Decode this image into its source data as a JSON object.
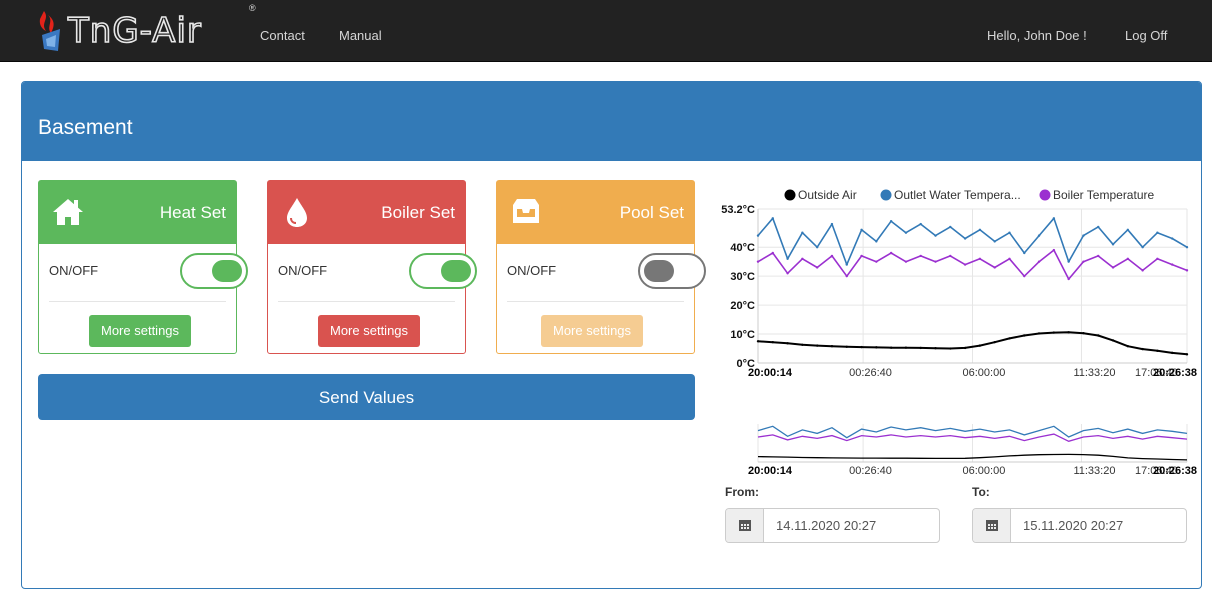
{
  "navbar": {
    "brand": "TnG-Air",
    "registered_mark": "®",
    "links": [
      "Contact",
      "Manual"
    ],
    "greeting": "Hello, John Doe !",
    "logoff": "Log Off",
    "background_color": "#222222"
  },
  "panel": {
    "title": "Basement",
    "heading_color": "#337ab7"
  },
  "cards": [
    {
      "title": "Heat Set",
      "icon": "home-icon",
      "toggle_label": "ON/OFF",
      "toggle_on": true,
      "button_label": "More settings",
      "color": "#5cb85c",
      "button_disabled": false
    },
    {
      "title": "Boiler Set",
      "icon": "water-drop-icon",
      "toggle_label": "ON/OFF",
      "toggle_on": true,
      "button_label": "More settings",
      "color": "#d9534f",
      "button_disabled": false
    },
    {
      "title": "Pool Set",
      "icon": "inbox-icon",
      "toggle_label": "ON/OFF",
      "toggle_on": false,
      "button_label": "More settings",
      "color": "#f0ad4e",
      "button_disabled": true
    }
  ],
  "send_button": "Send Values",
  "date_range": {
    "from_label": "From:",
    "to_label": "To:",
    "from_value": "14.11.2020 20:27",
    "to_value": "15.11.2020 20:27",
    "icon": "calendar-icon"
  },
  "chart_data": [
    {
      "type": "line",
      "legend_position": "top",
      "ylim": [
        0,
        53.2
      ],
      "y_tick_labels": [
        "0°C",
        "10°C",
        "20°C",
        "30°C",
        "40°C",
        "53.2°C"
      ],
      "x_tick_labels": [
        "20:00:14",
        "00:26:40",
        "06:00:00",
        "11:33:20",
        "17:06:40",
        "20:26:38"
      ],
      "grid": true,
      "series": [
        {
          "name": "Outside Air",
          "color": "#000000",
          "values": [
            7.5,
            7.2,
            6.8,
            6.3,
            6.0,
            5.8,
            5.6,
            5.5,
            5.4,
            5.3,
            5.3,
            5.2,
            5.1,
            5.0,
            5.2,
            6.0,
            7.2,
            8.5,
            9.5,
            10.2,
            10.5,
            10.6,
            10.3,
            9.5,
            7.8,
            5.8,
            4.8,
            4.2,
            3.5,
            3.0
          ]
        },
        {
          "name": "Outlet Water Tempera...",
          "color": "#337ab7",
          "values": [
            44,
            50,
            36,
            45,
            40,
            48,
            34,
            46,
            42,
            49,
            45,
            48,
            44,
            47,
            43,
            46,
            42,
            45,
            38,
            44,
            50,
            35,
            44,
            47,
            41,
            46,
            40,
            45,
            43,
            40
          ]
        },
        {
          "name": "Boiler Temperature",
          "color": "#9b30d0",
          "values": [
            35,
            38,
            31,
            36,
            33,
            37,
            30,
            37,
            35,
            38,
            35,
            37,
            35,
            37,
            34,
            36,
            33,
            36,
            30,
            35,
            39,
            29,
            35,
            37,
            33,
            36,
            32,
            36,
            34,
            32
          ]
        }
      ]
    },
    {
      "type": "line",
      "x_tick_labels": [
        "20:00:14",
        "00:26:40",
        "06:00:00",
        "11:33:20",
        "17:06:40",
        "20:26:38"
      ],
      "series": [
        {
          "color": "#000000",
          "values": [
            7.5,
            7.2,
            6.8,
            6.3,
            6.0,
            5.8,
            5.6,
            5.5,
            5.4,
            5.3,
            5.3,
            5.2,
            5.1,
            5.0,
            5.2,
            6.0,
            7.2,
            8.5,
            9.5,
            10.2,
            10.5,
            10.6,
            10.3,
            9.5,
            7.8,
            5.8,
            4.8,
            4.2,
            3.5,
            3.0
          ]
        },
        {
          "color": "#337ab7",
          "values": [
            44,
            50,
            36,
            45,
            40,
            48,
            34,
            46,
            42,
            49,
            45,
            48,
            44,
            47,
            43,
            46,
            42,
            45,
            38,
            44,
            50,
            35,
            44,
            47,
            41,
            46,
            40,
            45,
            43,
            40
          ]
        },
        {
          "color": "#9b30d0",
          "values": [
            35,
            38,
            31,
            36,
            33,
            37,
            30,
            37,
            35,
            38,
            35,
            37,
            35,
            37,
            34,
            36,
            33,
            36,
            30,
            35,
            39,
            29,
            35,
            37,
            33,
            36,
            32,
            36,
            34,
            32
          ]
        }
      ]
    }
  ]
}
